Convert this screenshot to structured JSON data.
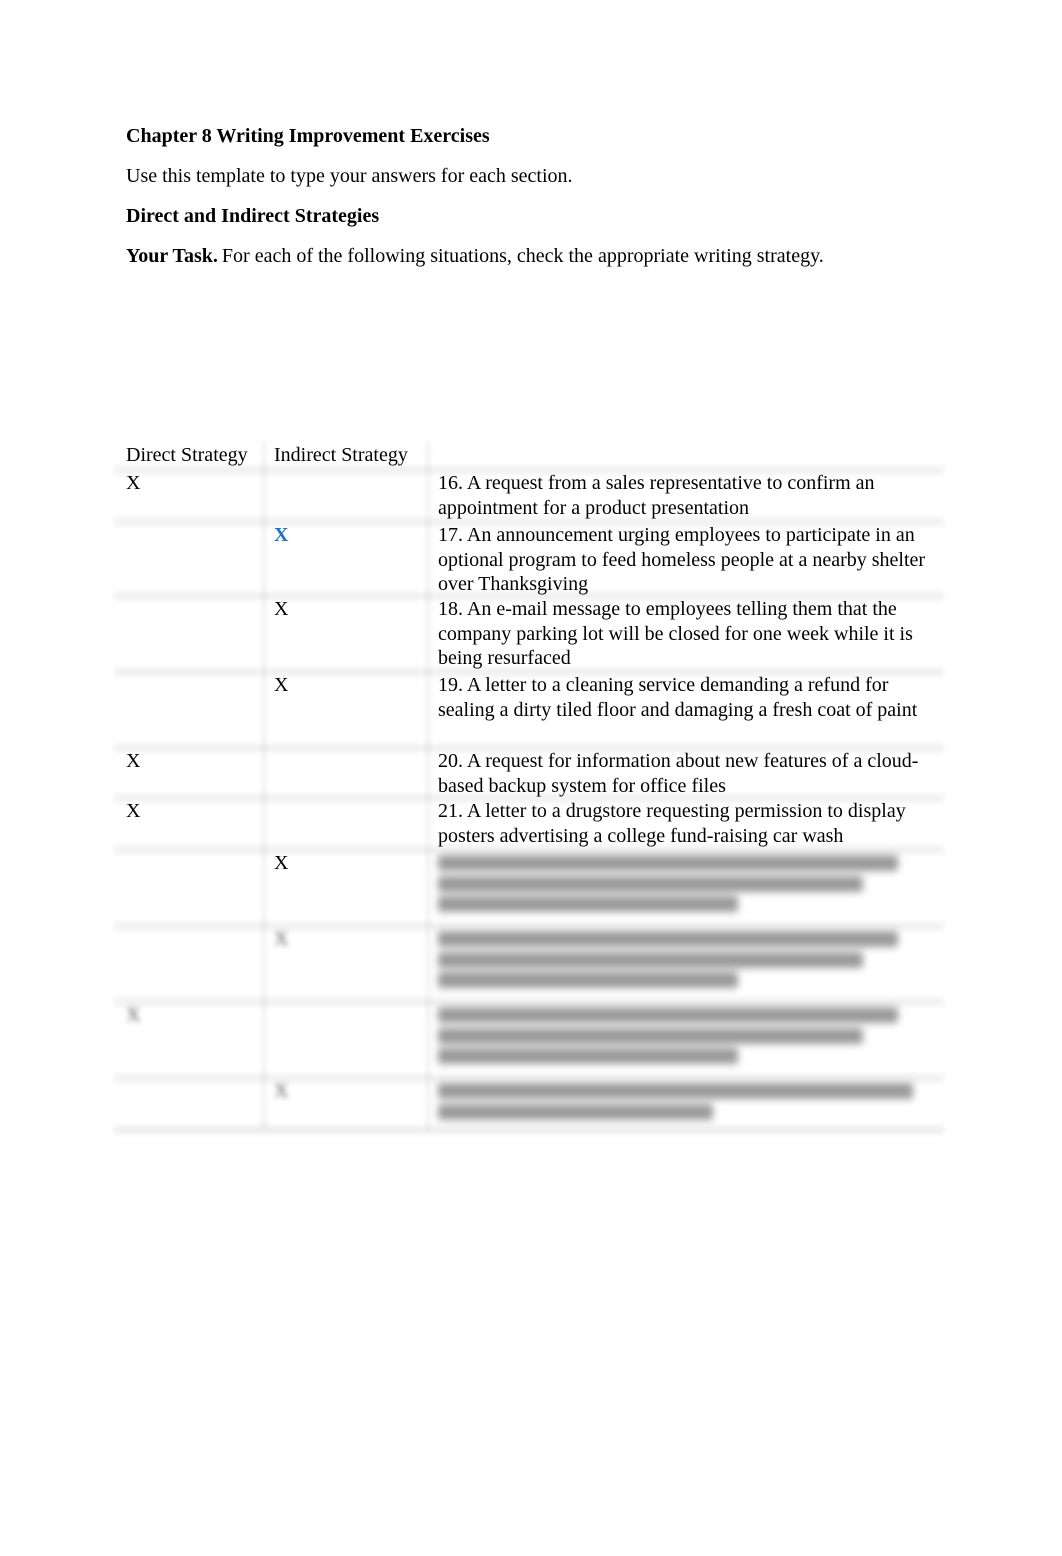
{
  "document": {
    "title": "Chapter 8 Writing Improvement Exercises",
    "intro": "Use this template to type your answers for each section.",
    "section_heading": "Direct and Indirect Strategies",
    "task_label": "Your Task.",
    "task_text": "For each of the following situations, check the appropriate writing strategy."
  },
  "table": {
    "headers": {
      "direct": "Direct Strategy",
      "indirect": "Indirect Strategy"
    },
    "accent_color": "#1f73c0",
    "rows": [
      {
        "direct": "X",
        "indirect": "",
        "text": "16. A request from a sales representative to confirm an appointment for a product presentation",
        "accent": false,
        "obscured": false
      },
      {
        "direct": "",
        "indirect": "X",
        "text": "17. An announcement urging employees to participate in an optional program to feed homeless people at a nearby shelter over Thanksgiving",
        "accent": true,
        "obscured": false
      },
      {
        "direct": "",
        "indirect": "X",
        "text": "18. An e-mail message to employees telling them that the company parking lot will be closed for one week while it is being resurfaced",
        "accent": false,
        "obscured": false
      },
      {
        "direct": "",
        "indirect": "X",
        "text": "19. A letter to a cleaning service demanding a refund for sealing a dirty tiled floor and damaging a fresh coat of paint",
        "accent": false,
        "obscured": false
      },
      {
        "direct": "X",
        "indirect": "",
        "text": "20. A request for information about new features of a cloud-based backup system for office files",
        "accent": false,
        "obscured": false
      },
      {
        "direct": "X",
        "indirect": "",
        "text": "21. A letter to a drugstore requesting permission to display posters advertising a college fund-raising car wash",
        "accent": false,
        "obscured": false
      },
      {
        "direct": "",
        "indirect": "X",
        "text": "",
        "accent": false,
        "obscured": true
      },
      {
        "direct": "",
        "indirect": "X",
        "text": "",
        "accent": false,
        "obscured": true
      },
      {
        "direct": "X",
        "indirect": "",
        "text": "",
        "accent": false,
        "obscured": true
      },
      {
        "direct": "",
        "indirect": "X",
        "text": "",
        "accent": false,
        "obscured": true
      }
    ]
  }
}
